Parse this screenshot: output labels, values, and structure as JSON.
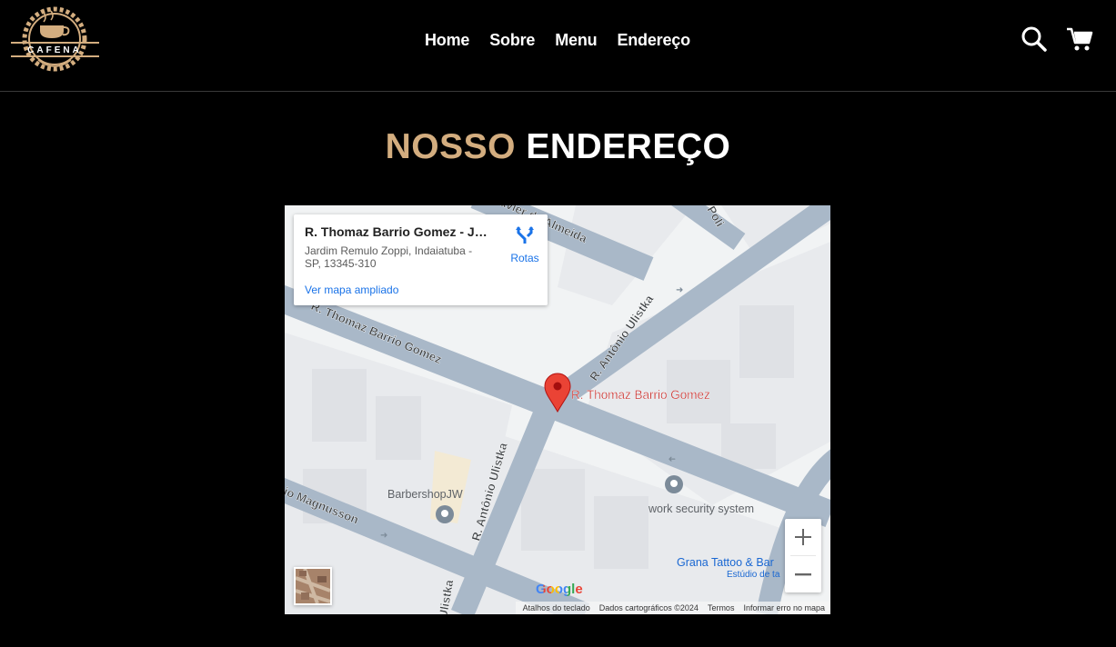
{
  "brand": {
    "name": "CAFENA",
    "accent_color": "#d3ad7f"
  },
  "nav": {
    "items": [
      "Home",
      "Sobre",
      "Menu",
      "Endereço"
    ]
  },
  "header_icons": {
    "search": "search-icon",
    "cart": "cart-icon"
  },
  "section": {
    "title_accent": "NOSSO",
    "title_main": "ENDEREÇO"
  },
  "map": {
    "info_title": "R. Thomaz Barrio Gomez - Jar...",
    "info_address": "Jardim Remulo Zoppi, Indaiatuba - SP, 13345-310",
    "view_larger": "Ver mapa ampliado",
    "routes_label": "Rotas",
    "marker_label": "R. Thomaz Barrio Gomez",
    "street_labels": {
      "almeida": "Xavier de Almeida",
      "poli": "Poli",
      "thomaz": "R. Thomaz Barrio Gomez",
      "ulistka_top": "R. Antônio Ulistka",
      "ulistka_mid": "R. Antônio Ulistka",
      "ulistka_bottom": "Ulistka",
      "magnusson": "io Magnusson"
    },
    "places": {
      "barbershop": "BarbershopJW",
      "work_security": "work security system",
      "grana_tattoo": "Grana Tattoo & Bar",
      "grana_tattoo_sub": "Estúdio de ta"
    },
    "google_logo": "Google",
    "footer": {
      "shortcuts": "Atalhos do teclado",
      "data": "Dados cartográficos ©2024",
      "terms": "Termos",
      "report": "Informar erro no mapa"
    }
  }
}
